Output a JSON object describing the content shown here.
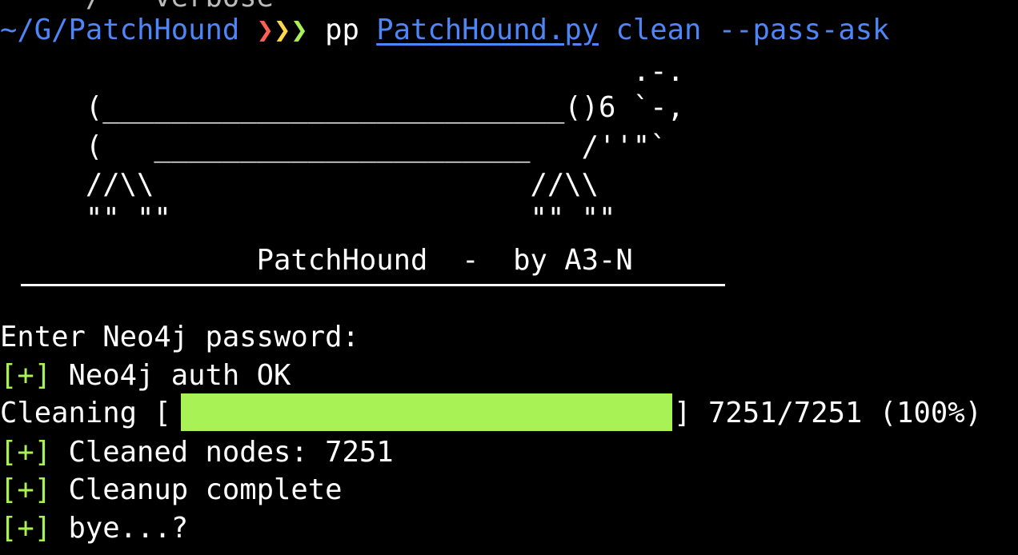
{
  "previous_line": {
    "text": "    -/   verbose"
  },
  "prompt": {
    "cwd": "~/G/PatchHound",
    "arrows": [
      "❯",
      "❯",
      "❯"
    ],
    "command": "pp",
    "script": "PatchHound.py",
    "args": "clean --pass-ask"
  },
  "banner": {
    "art": [
      "                                     .-.",
      "     (___________________________()6 `-,",
      "     (   ______________________   /''\"`",
      "     //\\\\                      //\\\\",
      "     \"\" \"\"                     \"\" \"\""
    ],
    "title": "               PatchHound  -  by A3-N"
  },
  "output": {
    "password_prompt": "Enter Neo4j password:",
    "marker": "[+]",
    "auth_ok": "Neo4j auth OK",
    "cleaning_label": "Cleaning [",
    "progress_close": "]",
    "progress_fraction": 1.0,
    "progress_stats": "7251/7251 (100%)",
    "cleaned_nodes": "Cleaned nodes: 7251",
    "cleanup_complete": "Cleanup complete",
    "bye": "bye...?"
  },
  "colors": {
    "background": "#000000",
    "prompt_path": "#4f86f7",
    "success_green": "#a9f255",
    "progress_fill": "#a9f255",
    "arrow_red": "#ff5f57",
    "arrow_yellow": "#ffd84a",
    "arrow_green": "#a9f255"
  }
}
